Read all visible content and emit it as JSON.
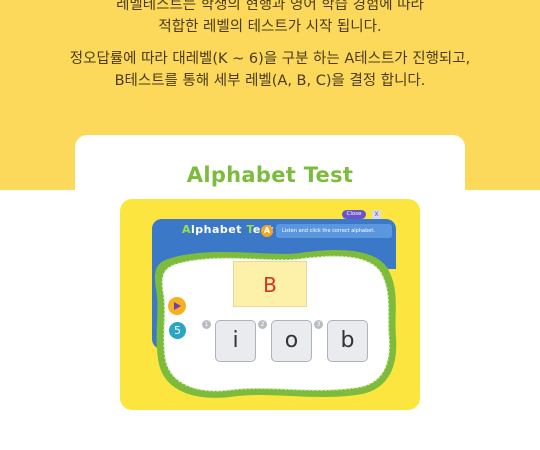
{
  "intro": {
    "line1": "레벨테스트는 학생의 현행과 영어 학습 경험에 따라",
    "line2": "적합한 레벨의 테스트가 시작 됩니다.",
    "line3": "정오답률에 따라 대레벨(K ~ 6)을 구분 하는 A테스트가 진행되고,",
    "line4": "B테스트를 통해  세부 레벨(A, B, C)을 결정 합니다."
  },
  "card": {
    "title": "Alphabet Test"
  },
  "game": {
    "title_accent_a": "A",
    "title_mid": "lphabet ",
    "title_accent_t": "T",
    "title_end": "est",
    "level": "A",
    "instruction": "Listen and click the correct alphabet.",
    "close_label": "Close",
    "close_x": "X",
    "prompt_letter": "B",
    "question_count": "5",
    "options": [
      {
        "num": "1",
        "letter": "i"
      },
      {
        "num": "2",
        "letter": "o"
      },
      {
        "num": "3",
        "letter": "b"
      }
    ]
  },
  "colors": {
    "band": "#fcd95a",
    "title_green": "#7dbb3c",
    "game_yellow": "#fde53f",
    "header_blue": "#3c78c8",
    "prompt_red": "#d9321f"
  }
}
